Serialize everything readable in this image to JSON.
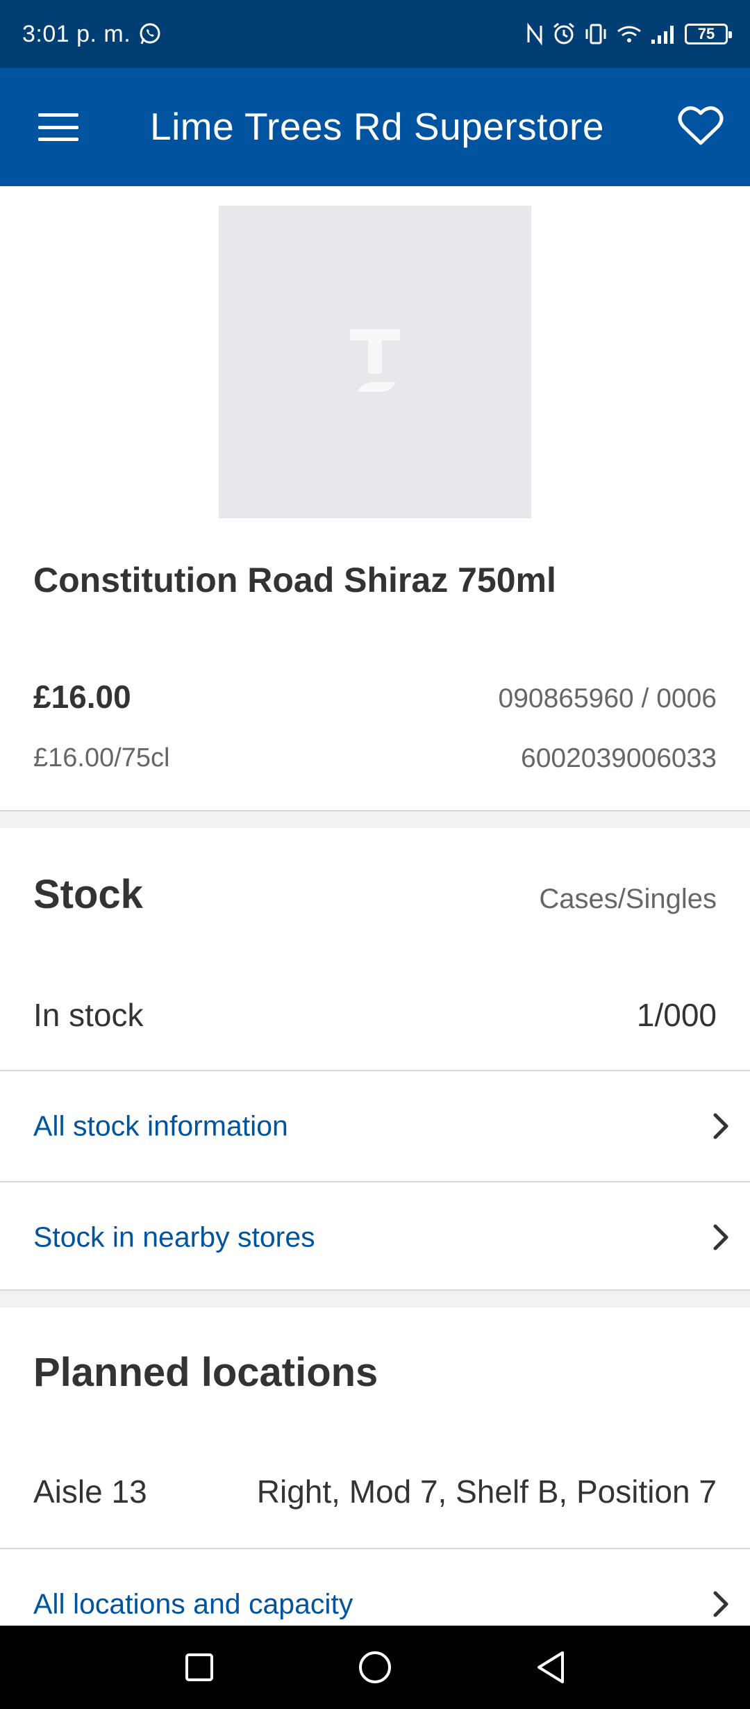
{
  "status_bar": {
    "time": "3:01 p. m.",
    "battery": "75"
  },
  "app_bar": {
    "title": "Lime Trees Rd Superstore"
  },
  "product": {
    "name": "Constitution Road Shiraz 750ml",
    "price": "£16.00",
    "unit_price": "£16.00/75cl",
    "product_code": "090865960 / 0006",
    "barcode": "6002039006033"
  },
  "stock": {
    "title": "Stock",
    "units": "Cases/Singles",
    "in_stock_label": "In stock",
    "in_stock_value": "1/000",
    "all_info_link": "All stock information",
    "nearby_link": "Stock in nearby stores"
  },
  "locations": {
    "title": "Planned locations",
    "aisle": "Aisle 13",
    "position": "Right, Mod 7, Shelf B, Position 7",
    "all_locations_link": "All locations and capacity"
  },
  "colors": {
    "status_bar": "#003e74",
    "app_bar": "#00539f",
    "link": "#00539f"
  },
  "icons": [
    "whatsapp-icon",
    "nfc-icon",
    "alarm-icon",
    "vibrate-icon",
    "wifi-icon",
    "signal-icon",
    "battery-icon",
    "menu-icon",
    "heart-icon",
    "chevron-right-icon",
    "recent-apps-icon",
    "home-icon",
    "back-icon"
  ]
}
